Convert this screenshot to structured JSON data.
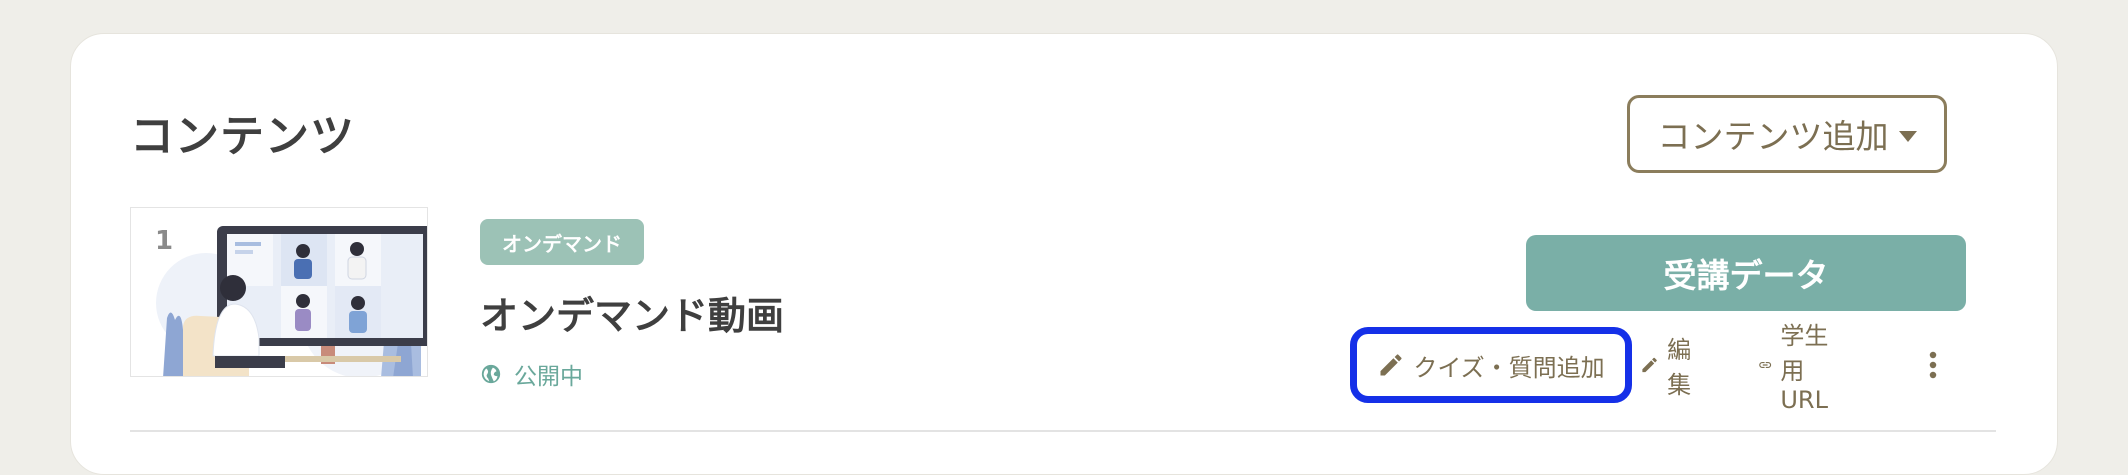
{
  "section": {
    "title": "コンテンツ",
    "add_button_label": "コンテンツ追加"
  },
  "content_item": {
    "index": "1",
    "type_badge": "オンデマンド",
    "title": "オンデマンド動画",
    "visibility": "公開中",
    "enroll_button_label": "受講データ",
    "actions": {
      "quiz_label": "クイズ・質問追加",
      "edit_label": "編集",
      "url_label": "学生用URL"
    }
  },
  "colors": {
    "accent_brown": "#7c6f52",
    "teal": "#7aafa7",
    "badge_teal": "#9cc2b6",
    "highlight_blue": "#1530e8"
  },
  "icons": [
    "caret-down-icon",
    "globe-icon",
    "pencil-icon",
    "link-icon",
    "more-vertical-icon"
  ]
}
